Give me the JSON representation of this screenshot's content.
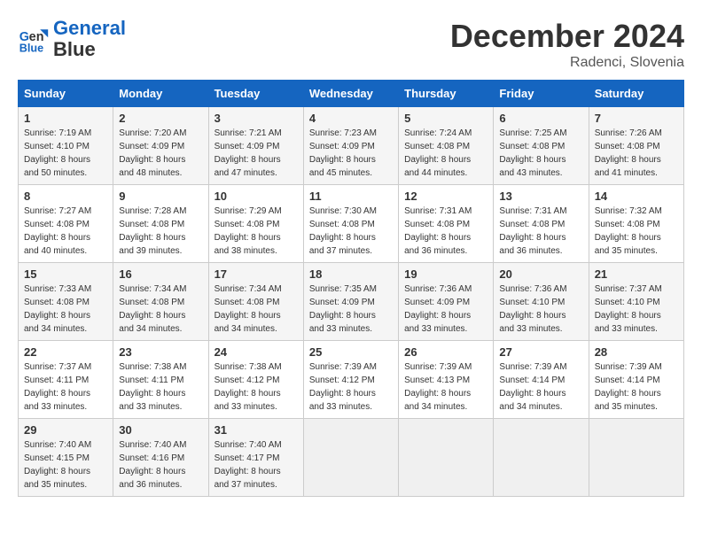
{
  "header": {
    "logo_line1": "General",
    "logo_line2": "Blue",
    "month_title": "December 2024",
    "location": "Radenci, Slovenia"
  },
  "days_of_week": [
    "Sunday",
    "Monday",
    "Tuesday",
    "Wednesday",
    "Thursday",
    "Friday",
    "Saturday"
  ],
  "weeks": [
    [
      {
        "day": 1,
        "sunrise": "7:19 AM",
        "sunset": "4:10 PM",
        "daylight": "8 hours and 50 minutes."
      },
      {
        "day": 2,
        "sunrise": "7:20 AM",
        "sunset": "4:09 PM",
        "daylight": "8 hours and 48 minutes."
      },
      {
        "day": 3,
        "sunrise": "7:21 AM",
        "sunset": "4:09 PM",
        "daylight": "8 hours and 47 minutes."
      },
      {
        "day": 4,
        "sunrise": "7:23 AM",
        "sunset": "4:09 PM",
        "daylight": "8 hours and 45 minutes."
      },
      {
        "day": 5,
        "sunrise": "7:24 AM",
        "sunset": "4:08 PM",
        "daylight": "8 hours and 44 minutes."
      },
      {
        "day": 6,
        "sunrise": "7:25 AM",
        "sunset": "4:08 PM",
        "daylight": "8 hours and 43 minutes."
      },
      {
        "day": 7,
        "sunrise": "7:26 AM",
        "sunset": "4:08 PM",
        "daylight": "8 hours and 41 minutes."
      }
    ],
    [
      {
        "day": 8,
        "sunrise": "7:27 AM",
        "sunset": "4:08 PM",
        "daylight": "8 hours and 40 minutes."
      },
      {
        "day": 9,
        "sunrise": "7:28 AM",
        "sunset": "4:08 PM",
        "daylight": "8 hours and 39 minutes."
      },
      {
        "day": 10,
        "sunrise": "7:29 AM",
        "sunset": "4:08 PM",
        "daylight": "8 hours and 38 minutes."
      },
      {
        "day": 11,
        "sunrise": "7:30 AM",
        "sunset": "4:08 PM",
        "daylight": "8 hours and 37 minutes."
      },
      {
        "day": 12,
        "sunrise": "7:31 AM",
        "sunset": "4:08 PM",
        "daylight": "8 hours and 36 minutes."
      },
      {
        "day": 13,
        "sunrise": "7:31 AM",
        "sunset": "4:08 PM",
        "daylight": "8 hours and 36 minutes."
      },
      {
        "day": 14,
        "sunrise": "7:32 AM",
        "sunset": "4:08 PM",
        "daylight": "8 hours and 35 minutes."
      }
    ],
    [
      {
        "day": 15,
        "sunrise": "7:33 AM",
        "sunset": "4:08 PM",
        "daylight": "8 hours and 34 minutes."
      },
      {
        "day": 16,
        "sunrise": "7:34 AM",
        "sunset": "4:08 PM",
        "daylight": "8 hours and 34 minutes."
      },
      {
        "day": 17,
        "sunrise": "7:34 AM",
        "sunset": "4:08 PM",
        "daylight": "8 hours and 34 minutes."
      },
      {
        "day": 18,
        "sunrise": "7:35 AM",
        "sunset": "4:09 PM",
        "daylight": "8 hours and 33 minutes."
      },
      {
        "day": 19,
        "sunrise": "7:36 AM",
        "sunset": "4:09 PM",
        "daylight": "8 hours and 33 minutes."
      },
      {
        "day": 20,
        "sunrise": "7:36 AM",
        "sunset": "4:10 PM",
        "daylight": "8 hours and 33 minutes."
      },
      {
        "day": 21,
        "sunrise": "7:37 AM",
        "sunset": "4:10 PM",
        "daylight": "8 hours and 33 minutes."
      }
    ],
    [
      {
        "day": 22,
        "sunrise": "7:37 AM",
        "sunset": "4:11 PM",
        "daylight": "8 hours and 33 minutes."
      },
      {
        "day": 23,
        "sunrise": "7:38 AM",
        "sunset": "4:11 PM",
        "daylight": "8 hours and 33 minutes."
      },
      {
        "day": 24,
        "sunrise": "7:38 AM",
        "sunset": "4:12 PM",
        "daylight": "8 hours and 33 minutes."
      },
      {
        "day": 25,
        "sunrise": "7:39 AM",
        "sunset": "4:12 PM",
        "daylight": "8 hours and 33 minutes."
      },
      {
        "day": 26,
        "sunrise": "7:39 AM",
        "sunset": "4:13 PM",
        "daylight": "8 hours and 34 minutes."
      },
      {
        "day": 27,
        "sunrise": "7:39 AM",
        "sunset": "4:14 PM",
        "daylight": "8 hours and 34 minutes."
      },
      {
        "day": 28,
        "sunrise": "7:39 AM",
        "sunset": "4:14 PM",
        "daylight": "8 hours and 35 minutes."
      }
    ],
    [
      {
        "day": 29,
        "sunrise": "7:40 AM",
        "sunset": "4:15 PM",
        "daylight": "8 hours and 35 minutes."
      },
      {
        "day": 30,
        "sunrise": "7:40 AM",
        "sunset": "4:16 PM",
        "daylight": "8 hours and 36 minutes."
      },
      {
        "day": 31,
        "sunrise": "7:40 AM",
        "sunset": "4:17 PM",
        "daylight": "8 hours and 37 minutes."
      },
      null,
      null,
      null,
      null
    ]
  ],
  "labels": {
    "sunrise": "Sunrise:",
    "sunset": "Sunset:",
    "daylight": "Daylight:"
  }
}
